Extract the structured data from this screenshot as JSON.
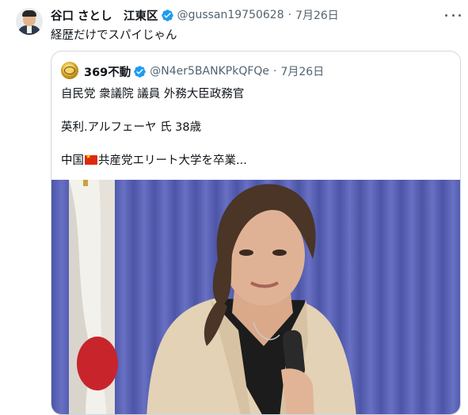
{
  "tweet": {
    "author_name": "谷口 さとし　江東区",
    "handle": "@gussan19750628",
    "separator": "·",
    "date": "7月26日",
    "text": "経歴だけでスパイじゃん"
  },
  "quoted": {
    "author_name": "369不動",
    "handle": "@N4er5BANKPkQFQe",
    "separator": "·",
    "date": "7月26日",
    "line1": "自民党 衆議院 議員 外務大臣政務官",
    "line2": "英利.アルフェーヤ 氏 38歳",
    "line3_before": "中国",
    "line3_after": "共産党エリート大学を卒業...",
    "flag_icon": "china-flag-emoji"
  },
  "colors": {
    "verified": "#1d9bf0",
    "muted_text": "#536471",
    "border": "#cfd9de",
    "curtain": "#5b63b8"
  }
}
